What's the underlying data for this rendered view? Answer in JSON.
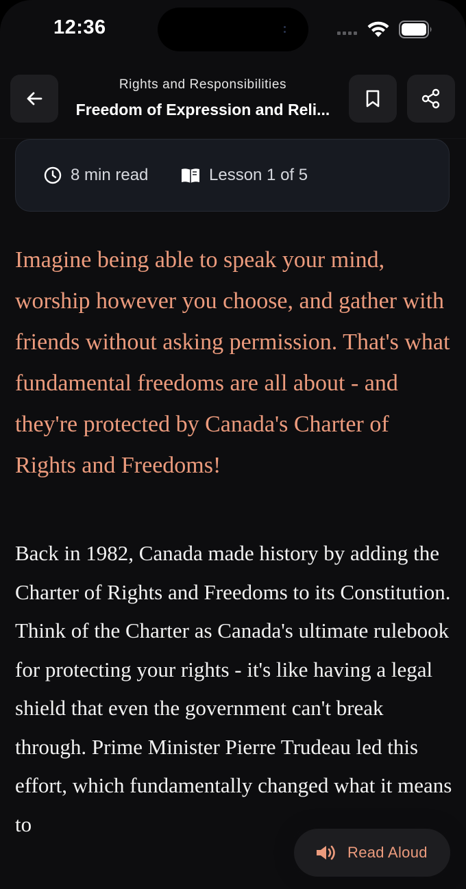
{
  "status_bar": {
    "time": "12:36"
  },
  "header": {
    "subtitle": "Rights and Responsibilities",
    "title": "Freedom of Expression and Reli...",
    "back_icon": "arrow-left-icon",
    "bookmark_icon": "bookmark-icon",
    "share_icon": "share-icon"
  },
  "meta": {
    "read_time": "8 min read",
    "lesson": "Lesson 1 of 5"
  },
  "content": {
    "intro": "Imagine being able to speak your mind, worship however you choose, and gather with friends without asking permission. That's what fundamental freedoms are all about - and they're protected by Canada's Charter of Rights and Freedoms!",
    "body": "Back in 1982, Canada made history by adding the Charter of Rights and Freedoms to its Constitution. Think of the Charter as Canada's ultimate rulebook for protecting your rights - it's like having a legal shield that even the government can't break through. Prime Minister Pierre Trudeau led this effort, which fundamentally changed what it means to"
  },
  "read_aloud": {
    "label": "Read Aloud",
    "icon": "speaker-icon"
  },
  "colors": {
    "accent": "#ec9b7d",
    "background": "#0d0d0f",
    "card": "#171a21"
  }
}
